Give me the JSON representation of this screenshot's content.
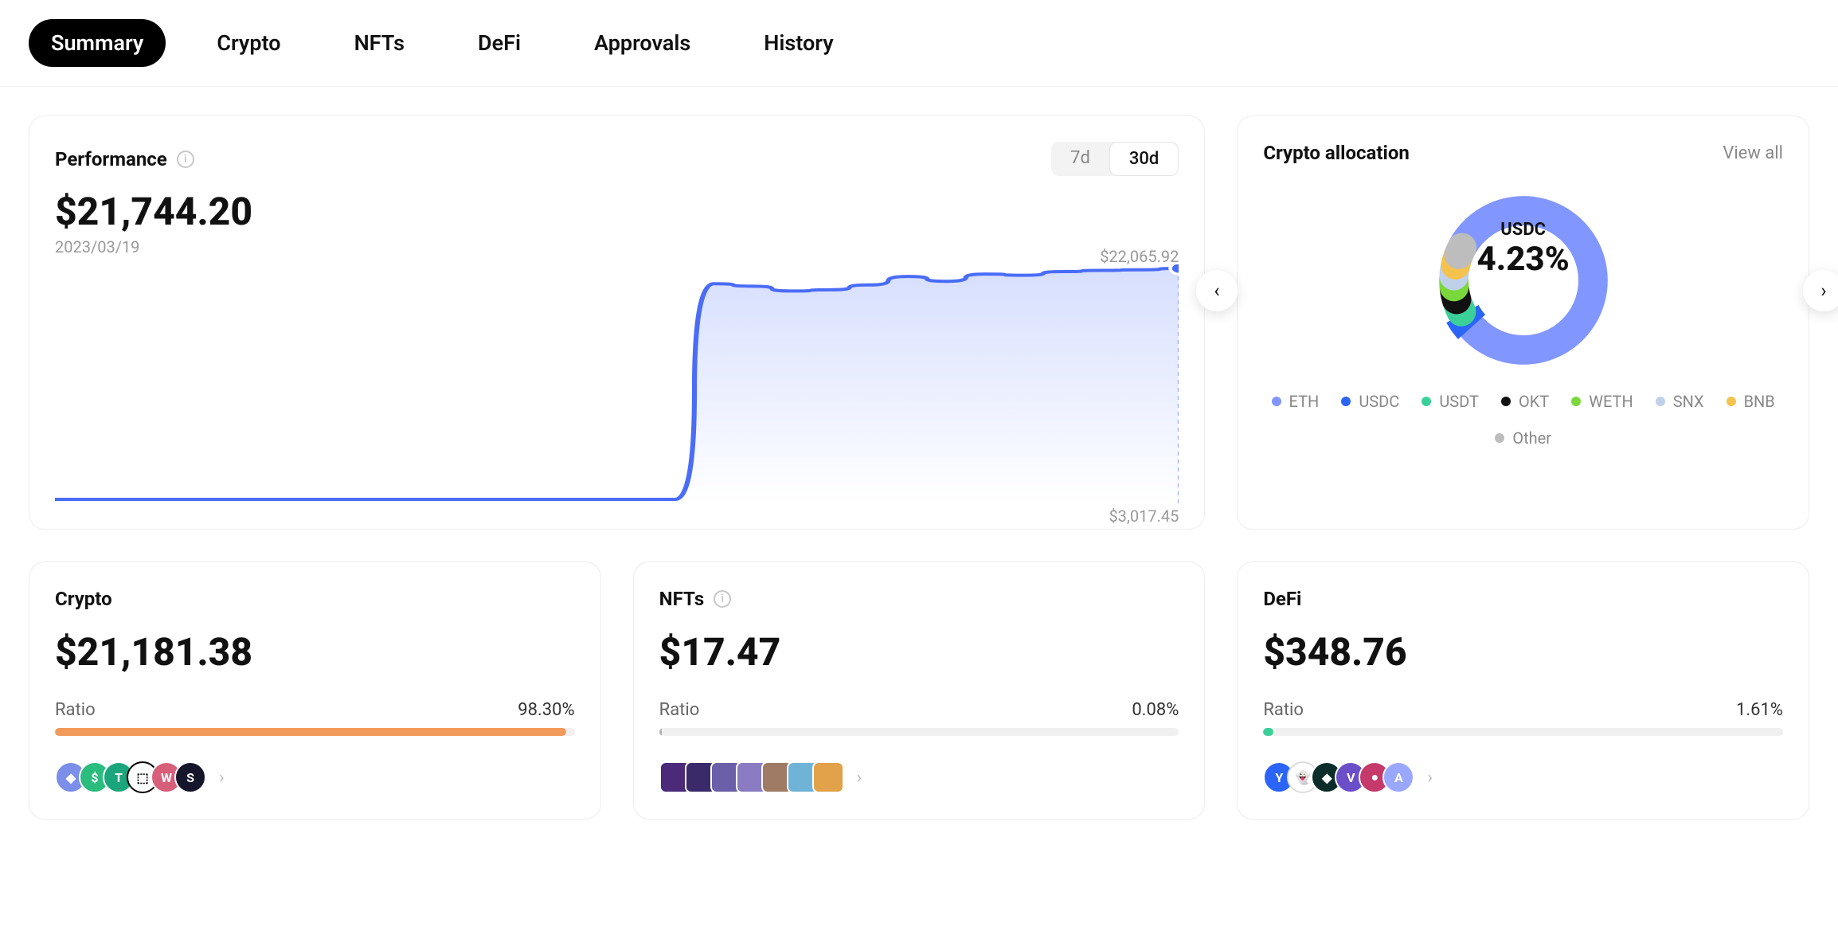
{
  "tabs": {
    "summary": "Summary",
    "crypto": "Crypto",
    "nfts": "NFTs",
    "defi": "DeFi",
    "approvals": "Approvals",
    "history": "History"
  },
  "performance": {
    "title": "Performance",
    "value": "$21,744.20",
    "date": "2023/03/19",
    "range7d": "7d",
    "range30d": "30d",
    "highLabel": "$22,065.92",
    "lowLabel": "$3,017.45"
  },
  "chart_data": {
    "type": "area",
    "title": "Performance",
    "xlabel": "",
    "ylabel": "",
    "x": [
      0,
      1,
      2,
      3,
      4,
      5,
      6,
      7,
      8,
      9,
      10,
      11,
      12,
      13,
      14,
      15,
      16,
      17,
      18,
      19,
      20,
      21,
      22,
      23,
      24,
      25,
      26,
      27,
      28,
      29
    ],
    "values": [
      3017.45,
      3017.45,
      3017.45,
      3017.45,
      3017.45,
      3017.45,
      3017.45,
      3017.45,
      3017.45,
      3017.45,
      3017.45,
      3017.45,
      3017.45,
      3017.45,
      3017.45,
      3017.45,
      3017.45,
      20800,
      20600,
      20200,
      20300,
      20700,
      21400,
      21000,
      21600,
      21500,
      21800,
      21900,
      21950,
      22065.92
    ],
    "ylim": [
      3017.45,
      22065.92
    ]
  },
  "allocation": {
    "title": "Crypto allocation",
    "viewAll": "View all",
    "centerLabel": "USDC",
    "centerPct": "4.23%",
    "items": [
      {
        "name": "ETH",
        "color": "#8196ff"
      },
      {
        "name": "USDC",
        "color": "#2b65f7"
      },
      {
        "name": "USDT",
        "color": "#3bcf9a"
      },
      {
        "name": "OKT",
        "color": "#111111"
      },
      {
        "name": "WETH",
        "color": "#7bd83c"
      },
      {
        "name": "SNX",
        "color": "#bfd1e9"
      },
      {
        "name": "BNB",
        "color": "#f5c24d"
      },
      {
        "name": "Other",
        "color": "#bdbdbd"
      }
    ]
  },
  "cards": {
    "crypto": {
      "title": "Crypto",
      "value": "$21,181.38",
      "ratioLabel": "Ratio",
      "ratioPct": "98.30%",
      "ratioWidth": "98.3%",
      "fillColor": "#f19a5b",
      "icons": [
        {
          "bg": "#7a8eea",
          "txt": "◆"
        },
        {
          "bg": "#2bbd7e",
          "txt": "$"
        },
        {
          "bg": "#1aa57c",
          "txt": "T"
        },
        {
          "bg": "#ffffff",
          "txt": "⬚",
          "fg": "#000",
          "bd": "#000"
        },
        {
          "bg": "#d85f7a",
          "txt": "W"
        },
        {
          "bg": "#15152b",
          "txt": "S"
        }
      ]
    },
    "nfts": {
      "title": "NFTs",
      "value": "$17.47",
      "ratioLabel": "Ratio",
      "ratioPct": "0.08%",
      "ratioWidth": "0.5%",
      "fillColor": "#b0b0b0",
      "thumbs": [
        "#4b2a7a",
        "#3b2a6a",
        "#6a5fa8",
        "#8b7bc2",
        "#9f7a64",
        "#6fb3d6",
        "#e2a24a"
      ]
    },
    "defi": {
      "title": "DeFi",
      "value": "$348.76",
      "ratioLabel": "Ratio",
      "ratioPct": "1.61%",
      "ratioWidth": "2%",
      "fillColor": "#3bcf9a",
      "icons": [
        {
          "bg": "#2b65f7",
          "txt": "Y"
        },
        {
          "bg": "#ffffff",
          "txt": "👻",
          "fg": "#555",
          "bd": "#ddd"
        },
        {
          "bg": "#0b2d2a",
          "txt": "◆"
        },
        {
          "bg": "#6b4fc9",
          "txt": "V"
        },
        {
          "bg": "#c53a6b",
          "txt": "●"
        },
        {
          "bg": "#9aa7ff",
          "txt": "A"
        }
      ]
    }
  }
}
